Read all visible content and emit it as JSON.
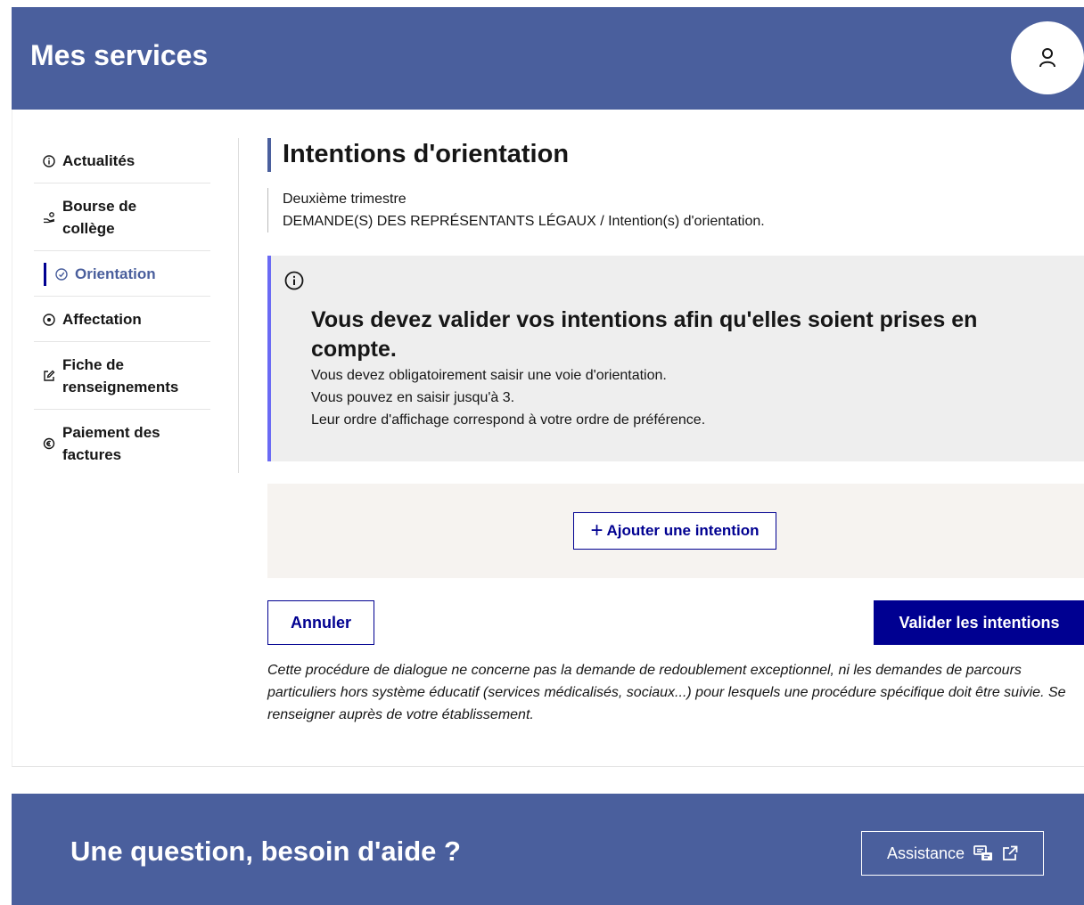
{
  "header": {
    "title": "Mes services",
    "user_icon": "user-icon"
  },
  "sidebar": {
    "items": [
      {
        "label": "Actualités",
        "icon": "info-icon"
      },
      {
        "label": "Bourse de collège",
        "icon": "scholarship-icon"
      },
      {
        "label": "Orientation",
        "icon": "compass-icon",
        "active": true
      },
      {
        "label": "Affectation",
        "icon": "compass-icon"
      },
      {
        "label": "Fiche de renseignements",
        "icon": "edit-icon"
      },
      {
        "label": "Paiement des factures",
        "icon": "payment-icon"
      }
    ]
  },
  "main": {
    "title": "Intentions d'orientation",
    "period": "Deuxième trimestre",
    "breadcrumb": "DEMANDE(S) DES REPRÉSENTANTS LÉGAUX / Intention(s) d'orientation.",
    "notice": {
      "icon": "info-icon",
      "title": "Vous devez valider vos intentions afin qu'elles soient prises en compte.",
      "lines": [
        "Vous devez obligatoirement saisir une voie d'orientation.",
        "Vous pouvez en saisir jusqu'à 3.",
        "Leur ordre d'affichage correspond à votre ordre de préférence."
      ]
    },
    "add_button": "Ajouter une intention",
    "cancel_button": "Annuler",
    "validate_button": "Valider les intentions",
    "disclaimer": "Cette procédure de dialogue ne concerne pas la demande de redoublement exceptionnel, ni les demandes de parcours particuliers hors système éducatif (services médicalisés, sociaux...) pour lesquels une procédure spécifique doit être suivie. Se renseigner auprès de votre établissement."
  },
  "footer": {
    "title": "Une question, besoin d'aide ?",
    "assist_button": "Assistance"
  },
  "colors": {
    "header_bg": "#4a5f9d",
    "primary": "#000091",
    "notice_border": "#6a6af4",
    "notice_bg": "#eeeeee",
    "add_zone_bg": "#f6f3f0"
  }
}
